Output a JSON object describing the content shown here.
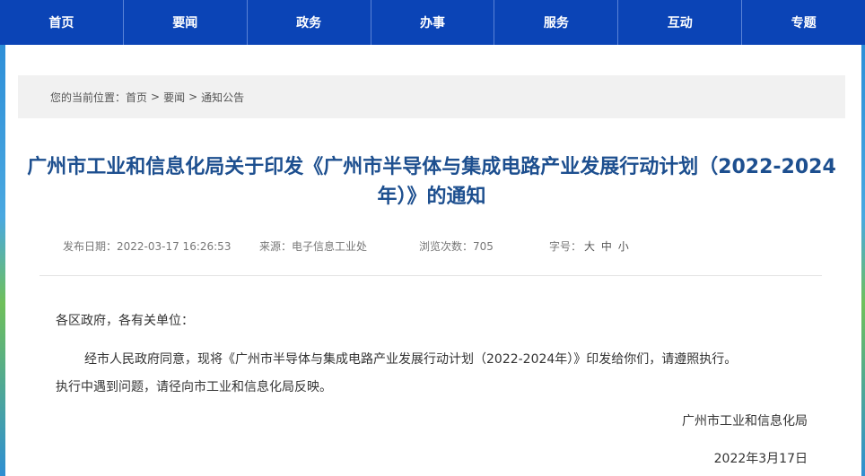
{
  "nav": {
    "items": [
      "首页",
      "要闻",
      "政务",
      "办事",
      "服务",
      "互动",
      "专题"
    ]
  },
  "breadcrumb": {
    "prefix": "您的当前位置：",
    "items": [
      "首页",
      "要闻",
      "通知公告"
    ],
    "separator": ">"
  },
  "article": {
    "title": "广州市工业和信息化局关于印发《广州市半导体与集成电路产业发展行动计划（2022-2024年）》的通知",
    "meta": {
      "publish_date": "发布日期：2022-03-17 16:26:53",
      "source": "来源：电子信息工业处",
      "views": "浏览次数：705",
      "font_size_label": "字号：",
      "font_sizes": [
        "大",
        "中",
        "小"
      ]
    },
    "greeting": "各区政府，各有关单位：",
    "paragraph_line1": "经市人民政府同意，现将《广州市半导体与集成电路产业发展行动计划（2022-2024年）》印发给你们，请遵照执行。",
    "paragraph_line2": "执行中遇到问题，请径向市工业和信息化局反映。",
    "signature": "广州市工业和信息化局",
    "date": "2022年3月17日"
  },
  "colors": {
    "nav_bg": "#0b44b6",
    "title": "#1d4f8f"
  }
}
